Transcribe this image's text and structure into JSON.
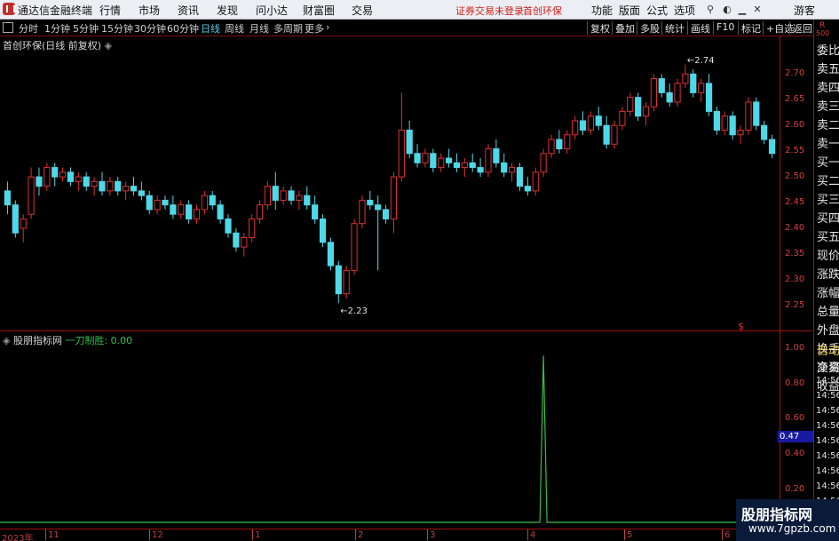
{
  "menu": {
    "app_title": "通达信金融终端",
    "items": [
      "行情",
      "市场",
      "资讯",
      "发现",
      "问小达",
      "财富圈",
      "交易"
    ],
    "notice": "证券交易未登录",
    "stock_name": "首创环保",
    "right_items": [
      "功能",
      "版面",
      "公式",
      "选项"
    ],
    "user": "游客"
  },
  "toolbar": {
    "periods": [
      "分时",
      "1分钟",
      "5分钟",
      "15分钟",
      "30分钟",
      "60分钟",
      "日线",
      "周线",
      "月线",
      "多周期",
      "更多"
    ],
    "active_period": "日线",
    "buttons": [
      "复权",
      "叠加",
      "多股",
      "统计",
      "画线",
      "F10",
      "标记",
      "+自选",
      "返回"
    ]
  },
  "chart": {
    "title": "首创环保(日线 前复权)",
    "high_label": "2.74",
    "low_label": "2.23",
    "dollar_mark": "$",
    "y_ticks": [
      "2.70",
      "2.65",
      "2.60",
      "2.55",
      "2.50",
      "2.45",
      "2.40",
      "2.35",
      "2.30",
      "2.25"
    ]
  },
  "indicator": {
    "name": "股朋指标网",
    "line_label": "一刀制胜: 0.00",
    "y_ticks": [
      "1.00",
      "0.80",
      "0.60",
      "0.40",
      "0.20"
    ],
    "crosshair_value": "0.47",
    "line_color": "#33c04a"
  },
  "x_axis": {
    "labels": [
      "2023年",
      "11",
      "12",
      "1",
      "2",
      "3",
      "4",
      "5",
      "6"
    ]
  },
  "sidebar": {
    "r_label": "R",
    "count_label": "500",
    "items": [
      "委比",
      "卖五",
      "卖四",
      "卖三",
      "卖二",
      "卖一",
      "买一",
      "买二",
      "买三",
      "买四",
      "买五",
      "现价",
      "涨跌",
      "涨幅",
      "总量",
      "外盘",
      "换手",
      "净资",
      "收益"
    ],
    "auto_trade": [
      "自动",
      "交易"
    ],
    "times": [
      "14:56",
      "14:56",
      "14:56",
      "14:56",
      "14:56",
      "14:56",
      "14:56",
      "14:56",
      "14:56"
    ]
  },
  "watermark": {
    "title": "股朋指标网",
    "url": "www.7gpzb.com"
  },
  "colors": {
    "up": "#e03030",
    "down": "#4fd8e8",
    "axis": "#a01010",
    "active_period": "#5ac8e8"
  },
  "chart_data": {
    "type": "candlestick",
    "title": "首创环保(日线 前复权)",
    "ylim": [
      2.2,
      2.77
    ],
    "x_labels": [
      "2023年",
      "11",
      "12",
      "1",
      "2",
      "3",
      "4",
      "5",
      "6"
    ],
    "annotations": [
      {
        "text": "2.74",
        "kind": "high"
      },
      {
        "text": "2.23",
        "kind": "low"
      }
    ],
    "candles": [
      {
        "o": 2.47,
        "h": 2.49,
        "l": 2.42,
        "c": 2.44
      },
      {
        "o": 2.44,
        "h": 2.45,
        "l": 2.37,
        "c": 2.38
      },
      {
        "o": 2.39,
        "h": 2.42,
        "l": 2.36,
        "c": 2.41
      },
      {
        "o": 2.42,
        "h": 2.52,
        "l": 2.41,
        "c": 2.5
      },
      {
        "o": 2.5,
        "h": 2.52,
        "l": 2.46,
        "c": 2.48
      },
      {
        "o": 2.48,
        "h": 2.53,
        "l": 2.47,
        "c": 2.52
      },
      {
        "o": 2.52,
        "h": 2.53,
        "l": 2.48,
        "c": 2.5
      },
      {
        "o": 2.5,
        "h": 2.52,
        "l": 2.49,
        "c": 2.51
      },
      {
        "o": 2.51,
        "h": 2.52,
        "l": 2.48,
        "c": 2.49
      },
      {
        "o": 2.49,
        "h": 2.51,
        "l": 2.47,
        "c": 2.5
      },
      {
        "o": 2.5,
        "h": 2.51,
        "l": 2.47,
        "c": 2.48
      },
      {
        "o": 2.48,
        "h": 2.5,
        "l": 2.46,
        "c": 2.49
      },
      {
        "o": 2.49,
        "h": 2.51,
        "l": 2.46,
        "c": 2.47
      },
      {
        "o": 2.47,
        "h": 2.5,
        "l": 2.46,
        "c": 2.49
      },
      {
        "o": 2.49,
        "h": 2.5,
        "l": 2.46,
        "c": 2.47
      },
      {
        "o": 2.47,
        "h": 2.49,
        "l": 2.45,
        "c": 2.48
      },
      {
        "o": 2.48,
        "h": 2.5,
        "l": 2.46,
        "c": 2.47
      },
      {
        "o": 2.47,
        "h": 2.49,
        "l": 2.45,
        "c": 2.46
      },
      {
        "o": 2.46,
        "h": 2.47,
        "l": 2.42,
        "c": 2.43
      },
      {
        "o": 2.43,
        "h": 2.46,
        "l": 2.42,
        "c": 2.45
      },
      {
        "o": 2.45,
        "h": 2.46,
        "l": 2.43,
        "c": 2.44
      },
      {
        "o": 2.44,
        "h": 2.46,
        "l": 2.41,
        "c": 2.42
      },
      {
        "o": 2.42,
        "h": 2.45,
        "l": 2.41,
        "c": 2.44
      },
      {
        "o": 2.44,
        "h": 2.45,
        "l": 2.4,
        "c": 2.41
      },
      {
        "o": 2.41,
        "h": 2.44,
        "l": 2.4,
        "c": 2.43
      },
      {
        "o": 2.43,
        "h": 2.47,
        "l": 2.42,
        "c": 2.46
      },
      {
        "o": 2.46,
        "h": 2.47,
        "l": 2.43,
        "c": 2.44
      },
      {
        "o": 2.44,
        "h": 2.45,
        "l": 2.4,
        "c": 2.41
      },
      {
        "o": 2.41,
        "h": 2.42,
        "l": 2.37,
        "c": 2.38
      },
      {
        "o": 2.38,
        "h": 2.39,
        "l": 2.34,
        "c": 2.35
      },
      {
        "o": 2.35,
        "h": 2.38,
        "l": 2.33,
        "c": 2.37
      },
      {
        "o": 2.37,
        "h": 2.42,
        "l": 2.36,
        "c": 2.41
      },
      {
        "o": 2.41,
        "h": 2.45,
        "l": 2.4,
        "c": 2.44
      },
      {
        "o": 2.44,
        "h": 2.49,
        "l": 2.43,
        "c": 2.48
      },
      {
        "o": 2.48,
        "h": 2.51,
        "l": 2.43,
        "c": 2.45
      },
      {
        "o": 2.45,
        "h": 2.48,
        "l": 2.44,
        "c": 2.47
      },
      {
        "o": 2.47,
        "h": 2.48,
        "l": 2.44,
        "c": 2.45
      },
      {
        "o": 2.45,
        "h": 2.47,
        "l": 2.43,
        "c": 2.46
      },
      {
        "o": 2.46,
        "h": 2.48,
        "l": 2.43,
        "c": 2.44
      },
      {
        "o": 2.44,
        "h": 2.46,
        "l": 2.4,
        "c": 2.41
      },
      {
        "o": 2.41,
        "h": 2.42,
        "l": 2.35,
        "c": 2.36
      },
      {
        "o": 2.36,
        "h": 2.37,
        "l": 2.3,
        "c": 2.31
      },
      {
        "o": 2.31,
        "h": 2.32,
        "l": 2.23,
        "c": 2.25
      },
      {
        "o": 2.25,
        "h": 2.31,
        "l": 2.24,
        "c": 2.3
      },
      {
        "o": 2.3,
        "h": 2.41,
        "l": 2.29,
        "c": 2.4
      },
      {
        "o": 2.4,
        "h": 2.46,
        "l": 2.39,
        "c": 2.45
      },
      {
        "o": 2.45,
        "h": 2.47,
        "l": 2.43,
        "c": 2.44
      },
      {
        "o": 2.44,
        "h": 2.46,
        "l": 2.3,
        "c": 2.43
      },
      {
        "o": 2.43,
        "h": 2.44,
        "l": 2.4,
        "c": 2.41
      },
      {
        "o": 2.41,
        "h": 2.51,
        "l": 2.38,
        "c": 2.5
      },
      {
        "o": 2.5,
        "h": 2.68,
        "l": 2.49,
        "c": 2.6
      },
      {
        "o": 2.6,
        "h": 2.62,
        "l": 2.54,
        "c": 2.55
      },
      {
        "o": 2.55,
        "h": 2.57,
        "l": 2.52,
        "c": 2.53
      },
      {
        "o": 2.53,
        "h": 2.56,
        "l": 2.52,
        "c": 2.55
      },
      {
        "o": 2.55,
        "h": 2.56,
        "l": 2.51,
        "c": 2.52
      },
      {
        "o": 2.52,
        "h": 2.55,
        "l": 2.51,
        "c": 2.54
      },
      {
        "o": 2.54,
        "h": 2.56,
        "l": 2.52,
        "c": 2.53
      },
      {
        "o": 2.53,
        "h": 2.55,
        "l": 2.51,
        "c": 2.52
      },
      {
        "o": 2.52,
        "h": 2.54,
        "l": 2.5,
        "c": 2.53
      },
      {
        "o": 2.53,
        "h": 2.55,
        "l": 2.51,
        "c": 2.52
      },
      {
        "o": 2.52,
        "h": 2.54,
        "l": 2.5,
        "c": 2.51
      },
      {
        "o": 2.51,
        "h": 2.57,
        "l": 2.5,
        "c": 2.56
      },
      {
        "o": 2.56,
        "h": 2.58,
        "l": 2.52,
        "c": 2.53
      },
      {
        "o": 2.53,
        "h": 2.55,
        "l": 2.5,
        "c": 2.51
      },
      {
        "o": 2.51,
        "h": 2.53,
        "l": 2.49,
        "c": 2.52
      },
      {
        "o": 2.52,
        "h": 2.53,
        "l": 2.47,
        "c": 2.48
      },
      {
        "o": 2.48,
        "h": 2.5,
        "l": 2.46,
        "c": 2.47
      },
      {
        "o": 2.47,
        "h": 2.52,
        "l": 2.46,
        "c": 2.51
      },
      {
        "o": 2.51,
        "h": 2.56,
        "l": 2.5,
        "c": 2.55
      },
      {
        "o": 2.55,
        "h": 2.59,
        "l": 2.54,
        "c": 2.58
      },
      {
        "o": 2.58,
        "h": 2.6,
        "l": 2.55,
        "c": 2.56
      },
      {
        "o": 2.56,
        "h": 2.6,
        "l": 2.55,
        "c": 2.59
      },
      {
        "o": 2.59,
        "h": 2.63,
        "l": 2.58,
        "c": 2.62
      },
      {
        "o": 2.62,
        "h": 2.64,
        "l": 2.59,
        "c": 2.6
      },
      {
        "o": 2.6,
        "h": 2.64,
        "l": 2.59,
        "c": 2.63
      },
      {
        "o": 2.63,
        "h": 2.65,
        "l": 2.6,
        "c": 2.61
      },
      {
        "o": 2.61,
        "h": 2.63,
        "l": 2.56,
        "c": 2.57
      },
      {
        "o": 2.57,
        "h": 2.62,
        "l": 2.56,
        "c": 2.61
      },
      {
        "o": 2.61,
        "h": 2.65,
        "l": 2.6,
        "c": 2.64
      },
      {
        "o": 2.64,
        "h": 2.68,
        "l": 2.63,
        "c": 2.67
      },
      {
        "o": 2.67,
        "h": 2.68,
        "l": 2.62,
        "c": 2.63
      },
      {
        "o": 2.63,
        "h": 2.66,
        "l": 2.61,
        "c": 2.65
      },
      {
        "o": 2.65,
        "h": 2.72,
        "l": 2.64,
        "c": 2.71
      },
      {
        "o": 2.71,
        "h": 2.72,
        "l": 2.67,
        "c": 2.68
      },
      {
        "o": 2.68,
        "h": 2.7,
        "l": 2.65,
        "c": 2.66
      },
      {
        "o": 2.66,
        "h": 2.71,
        "l": 2.65,
        "c": 2.7
      },
      {
        "o": 2.7,
        "h": 2.74,
        "l": 2.69,
        "c": 2.72
      },
      {
        "o": 2.72,
        "h": 2.73,
        "l": 2.67,
        "c": 2.68
      },
      {
        "o": 2.68,
        "h": 2.71,
        "l": 2.66,
        "c": 2.7
      },
      {
        "o": 2.7,
        "h": 2.72,
        "l": 2.63,
        "c": 2.64
      },
      {
        "o": 2.64,
        "h": 2.65,
        "l": 2.59,
        "c": 2.6
      },
      {
        "o": 2.6,
        "h": 2.64,
        "l": 2.59,
        "c": 2.63
      },
      {
        "o": 2.63,
        "h": 2.64,
        "l": 2.58,
        "c": 2.59
      },
      {
        "o": 2.59,
        "h": 2.61,
        "l": 2.57,
        "c": 2.6
      },
      {
        "o": 2.6,
        "h": 2.67,
        "l": 2.59,
        "c": 2.66
      },
      {
        "o": 2.66,
        "h": 2.67,
        "l": 2.6,
        "c": 2.61
      },
      {
        "o": 2.61,
        "h": 2.62,
        "l": 2.57,
        "c": 2.58
      },
      {
        "o": 2.58,
        "h": 2.59,
        "l": 2.54,
        "c": 2.55
      }
    ],
    "indicator_series": {
      "name": "一刀制胜",
      "ylim": [
        0,
        1.05
      ],
      "spike_index": 68,
      "spike_value": 1.0,
      "baseline": 0.0
    }
  }
}
